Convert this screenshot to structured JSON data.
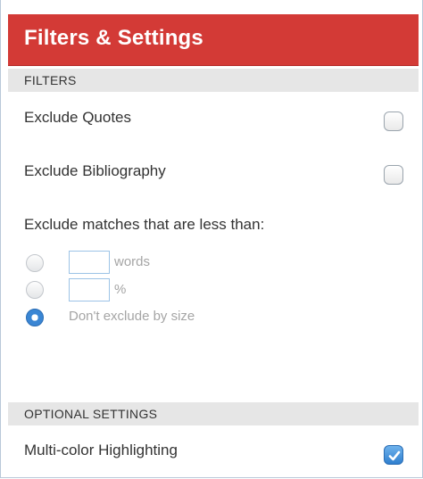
{
  "header": {
    "title": "Filters & Settings"
  },
  "filters": {
    "section_title": "FILTERS",
    "exclude_quotes": {
      "label": "Exclude Quotes",
      "checked": false
    },
    "exclude_bibliography": {
      "label": "Exclude Bibliography",
      "checked": false
    },
    "exclude_matches_label": "Exclude matches that are less than:",
    "size_options": [
      {
        "input_value": "",
        "unit": "words",
        "selected": false
      },
      {
        "input_value": "",
        "unit": "%",
        "selected": false
      },
      {
        "label": "Don't exclude by size",
        "selected": true
      }
    ]
  },
  "optional_settings": {
    "section_title": "OPTIONAL SETTINGS",
    "multi_color": {
      "label": "Multi-color Highlighting",
      "checked": true
    }
  },
  "colors": {
    "header": "#d33a36",
    "accent": "#3a86d4"
  }
}
